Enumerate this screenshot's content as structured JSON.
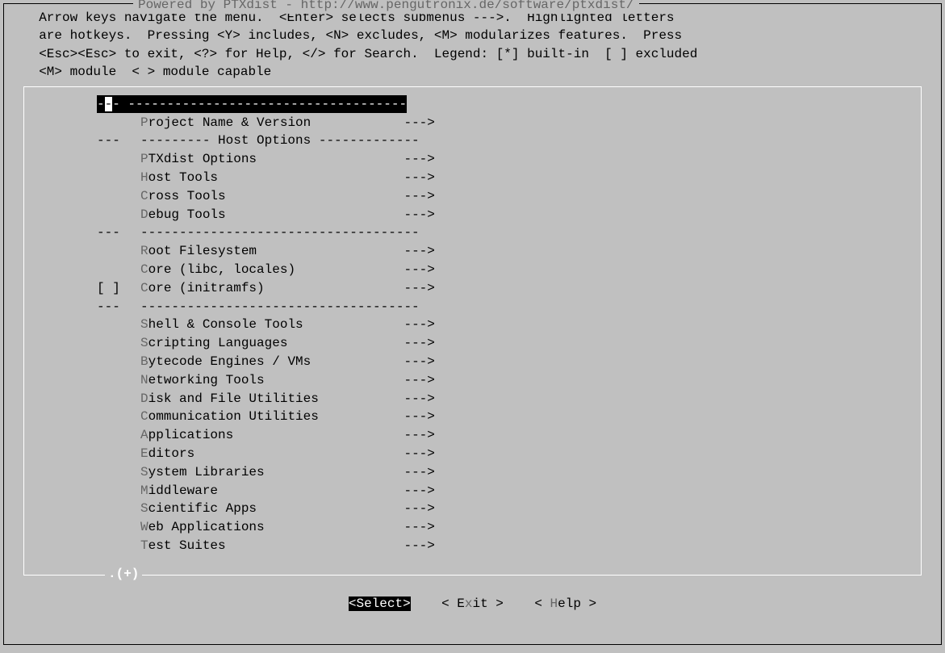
{
  "title": {
    "left": "Powered by PTXdist - ",
    "url_prefix": "h",
    "url_rest": "ttp://www.pengutronix.de/software/ptxdist/"
  },
  "help": "  Arrow keys navigate the menu.  <Enter> selects submenus --->.  Highlighted letters\n  are hotkeys.  Pressing <Y> includes, <N> excludes, <M> modularizes features.  Press\n  <Esc><Esc> to exit, <?> for Help, </> for Search.  Legend: [*] built-in  [ ] excluded\n  <M> module  < > module capable",
  "menu": [
    {
      "type": "sel",
      "prefix": "-",
      "cursor": "-",
      "mid": "-",
      "label": " ------------------------------------",
      "arrow": "",
      "hot": ""
    },
    {
      "type": "item",
      "prefix": "    ",
      "hot": "P",
      "label": "roject Name & Version            ",
      "arrow": "--->"
    },
    {
      "type": "sep",
      "prefix": "--- ",
      "label": "--------- Host Options -------------",
      "arrow": ""
    },
    {
      "type": "item",
      "prefix": "    ",
      "hot": "P",
      "label": "TXdist Options                   ",
      "arrow": "--->"
    },
    {
      "type": "item",
      "prefix": "    ",
      "hot": "H",
      "label": "ost Tools                        ",
      "arrow": "--->"
    },
    {
      "type": "item",
      "prefix": "    ",
      "hot": "C",
      "label": "ross Tools                       ",
      "arrow": "--->"
    },
    {
      "type": "item",
      "prefix": "    ",
      "hot": "D",
      "label": "ebug Tools                       ",
      "arrow": "--->"
    },
    {
      "type": "sep",
      "prefix": "--- ",
      "label": "------------------------------------",
      "arrow": ""
    },
    {
      "type": "item",
      "prefix": "    ",
      "hot": "R",
      "label": "oot Filesystem                   ",
      "arrow": "--->"
    },
    {
      "type": "item",
      "prefix": "    ",
      "hot": "C",
      "label": "ore (libc, locales)              ",
      "arrow": "--->"
    },
    {
      "type": "item",
      "prefix": "[ ] ",
      "hot": "C",
      "label": "ore (initramfs)                  ",
      "arrow": "--->"
    },
    {
      "type": "sep",
      "prefix": "--- ",
      "label": "------------------------------------",
      "arrow": ""
    },
    {
      "type": "item",
      "prefix": "    ",
      "hot": "S",
      "label": "hell & Console Tools             ",
      "arrow": "--->"
    },
    {
      "type": "item",
      "prefix": "    ",
      "hot": "S",
      "label": "cripting Languages               ",
      "arrow": "--->"
    },
    {
      "type": "item",
      "prefix": "    ",
      "hot": "B",
      "label": "ytecode Engines / VMs            ",
      "arrow": "--->"
    },
    {
      "type": "item",
      "prefix": "    ",
      "hot": "N",
      "label": "etworking Tools                  ",
      "arrow": "--->"
    },
    {
      "type": "item",
      "prefix": "    ",
      "hot": "D",
      "label": "isk and File Utilities           ",
      "arrow": "--->"
    },
    {
      "type": "item",
      "prefix": "    ",
      "hot": "C",
      "label": "ommunication Utilities           ",
      "arrow": "--->"
    },
    {
      "type": "item",
      "prefix": "    ",
      "hot": "A",
      "label": "pplications                      ",
      "arrow": "--->"
    },
    {
      "type": "item",
      "prefix": "    ",
      "hot": "E",
      "label": "ditors                           ",
      "arrow": "--->"
    },
    {
      "type": "item",
      "prefix": "    ",
      "hot": "S",
      "label": "ystem Libraries                  ",
      "arrow": "--->"
    },
    {
      "type": "item",
      "prefix": "    ",
      "hot": "M",
      "label": "iddleware                        ",
      "arrow": "--->"
    },
    {
      "type": "item",
      "prefix": "    ",
      "hot": "S",
      "label": "cientific Apps                   ",
      "arrow": "--->"
    },
    {
      "type": "item",
      "prefix": "    ",
      "hot": "W",
      "label": "eb Applications                  ",
      "arrow": "--->"
    },
    {
      "type": "item",
      "prefix": "    ",
      "hot": "T",
      "label": "est Suites                       ",
      "arrow": "--->"
    }
  ],
  "more": ".(+)",
  "buttons": {
    "select": "<Select>",
    "exit_l": "< E",
    "exit_k": "x",
    "exit_r": "it >",
    "help_l": "< ",
    "help_k": "H",
    "help_r": "elp >",
    "gap1": "    ",
    "gap2": "    "
  }
}
